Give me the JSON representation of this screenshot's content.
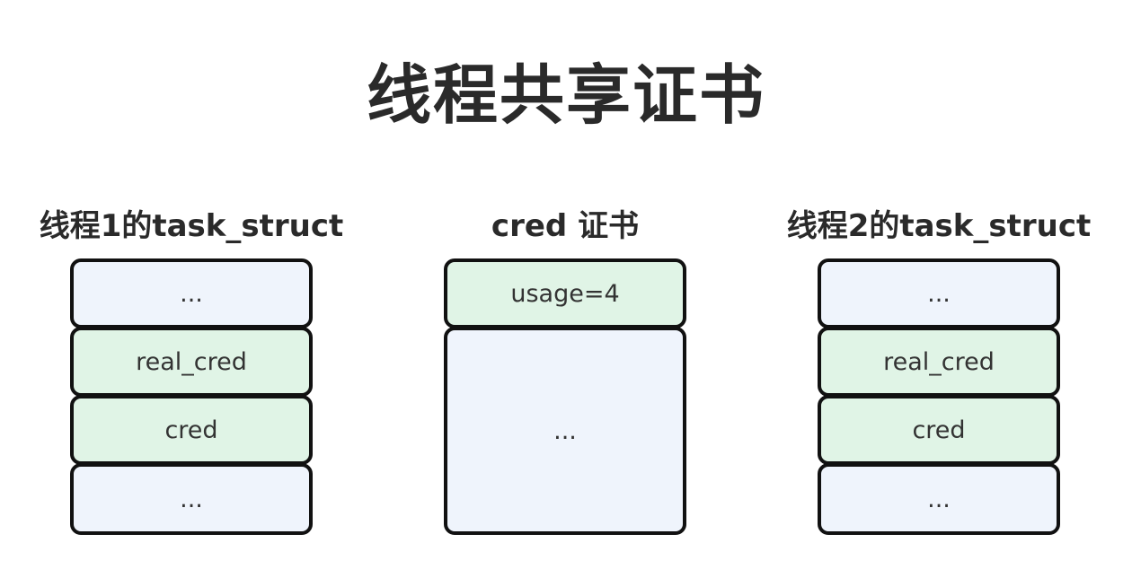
{
  "title": "线程共享证书",
  "columns": {
    "thread1": {
      "label": "线程1的task_struct",
      "fields": [
        "...",
        "real_cred",
        "cred",
        "..."
      ]
    },
    "cred": {
      "label": "cred 证书",
      "fields": [
        "usage=4",
        "..."
      ]
    },
    "thread2": {
      "label": "线程2的task_struct",
      "fields": [
        "...",
        "real_cred",
        "cred",
        "..."
      ]
    }
  },
  "colors": {
    "pointer_field": "#e0f4e6",
    "plain_field": "#eff4fc",
    "border": "#111111"
  }
}
